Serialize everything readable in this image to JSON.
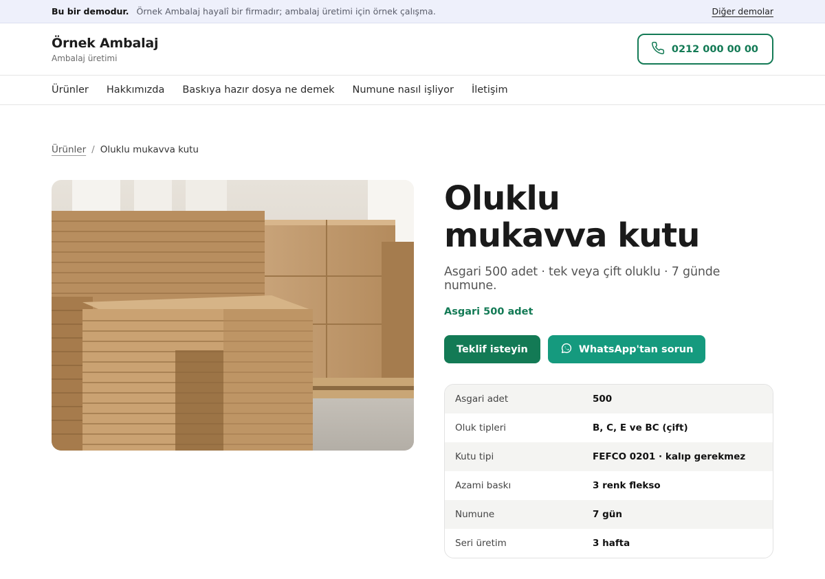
{
  "demo_bar": {
    "label": "Bu bir demodur.",
    "text": "Örnek Ambalaj hayalî bir firmadır; ambalaj üretimi için örnek çalışma.",
    "link": "Diğer demolar"
  },
  "header": {
    "brand": "Örnek Ambalaj",
    "tagline": "Ambalaj üretimi",
    "phone": "0212 000 00 00",
    "phone_icon": "phone-icon"
  },
  "nav": {
    "items": [
      "Ürünler",
      "Hakkımızda",
      "Baskıya hazır dosya ne demek",
      "Numune nasıl işliyor",
      "İletişim"
    ]
  },
  "breadcrumb": {
    "parent": "Ürünler",
    "separator": "/",
    "current": "Oluklu mukavva kutu"
  },
  "product": {
    "title_line1": "Oluklu",
    "title_line2": "mukavva kutu",
    "subtitle": "Asgari 500 adet · tek veya çift oluklu · 7 günde numune.",
    "moq": "Asgari 500 adet",
    "quote_button": "Teklif isteyin",
    "whatsapp_button": "WhatsApp'tan sorun",
    "whatsapp_icon": "whatsapp-icon",
    "image_alt": "cardboard-boxes-image"
  },
  "specs": [
    {
      "label": "Asgari adet",
      "value": "500"
    },
    {
      "label": "Oluk tipleri",
      "value": "B, C, E ve BC (çift)"
    },
    {
      "label": "Kutu tipi",
      "value": "FEFCO 0201 · kalıp gerekmez"
    },
    {
      "label": "Azami baskı",
      "value": "3 renk flekso"
    },
    {
      "label": "Numune",
      "value": "7 gün"
    },
    {
      "label": "Seri üretim",
      "value": "3 hafta"
    }
  ],
  "colors": {
    "accent": "#137a55",
    "whatsapp": "#159a7e",
    "demo_bar_bg": "#eef0fb"
  }
}
